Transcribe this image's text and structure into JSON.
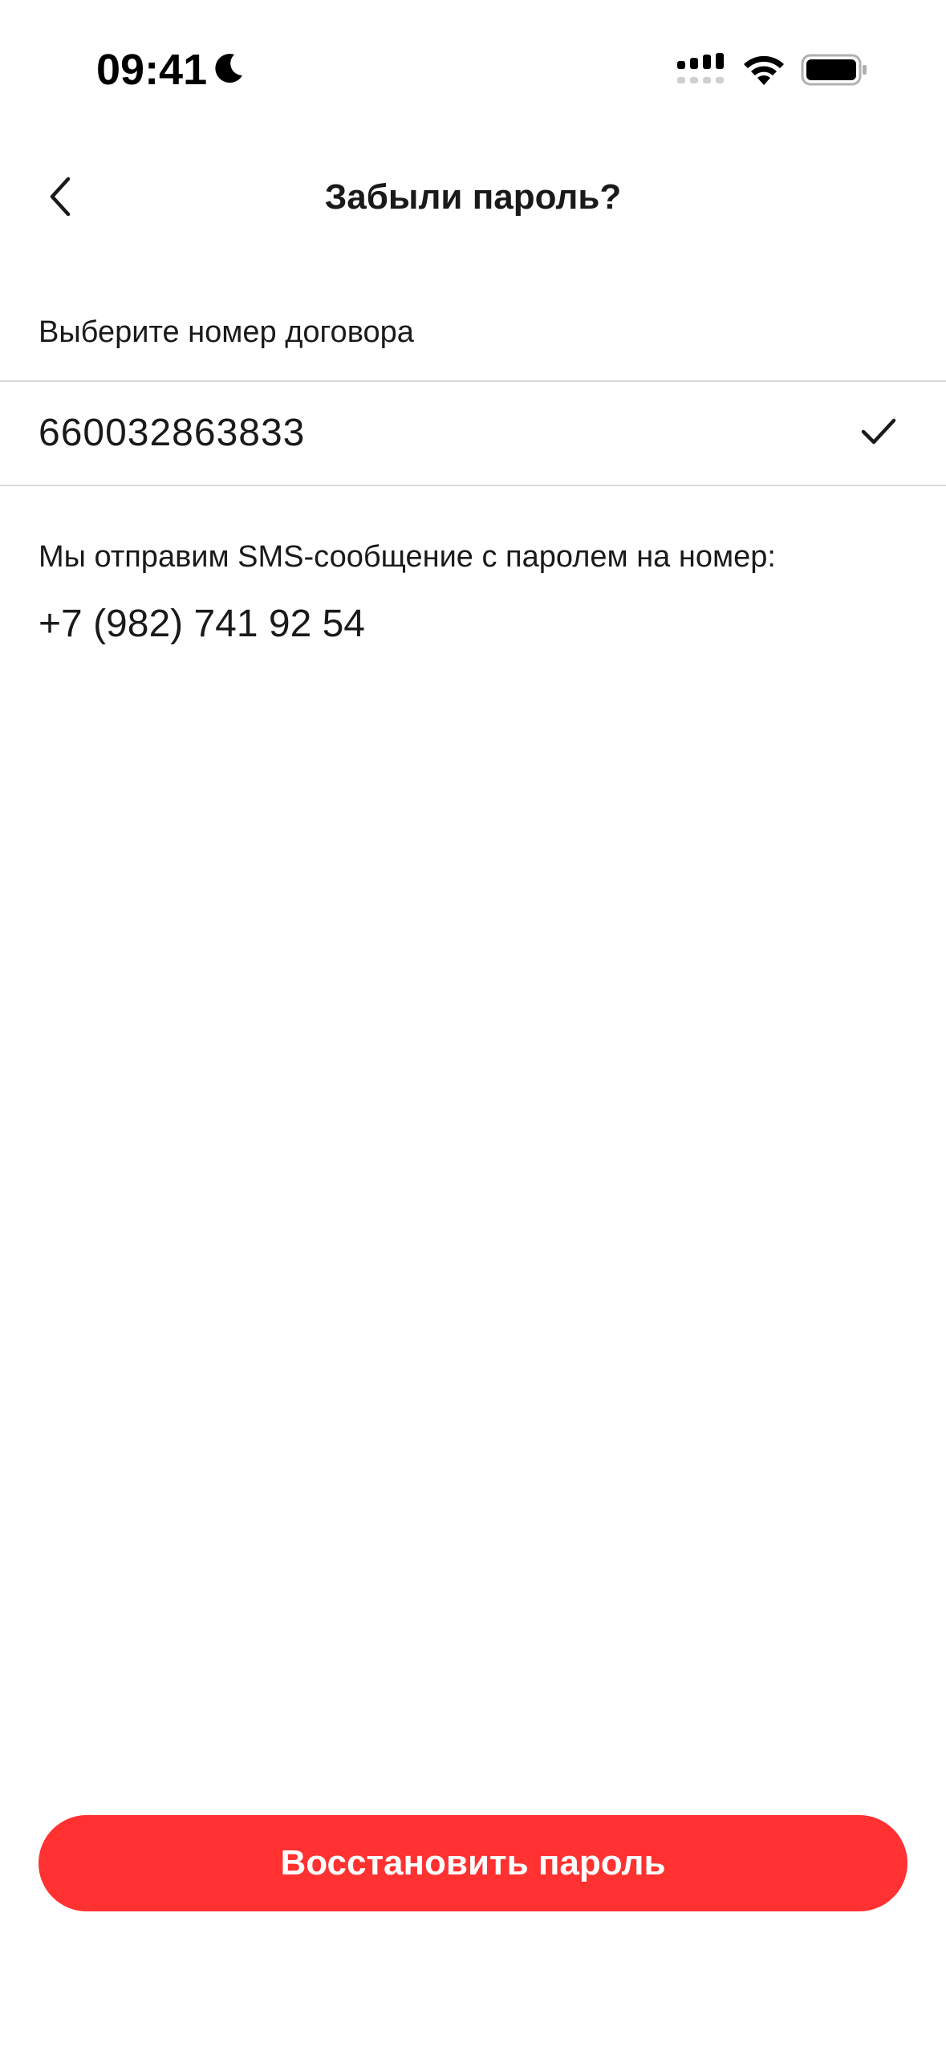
{
  "status_bar": {
    "time": "09:41"
  },
  "header": {
    "title": "Забыли пароль?"
  },
  "contract": {
    "label": "Выберите номер договора",
    "selected_number": "660032863833"
  },
  "sms": {
    "info_text": "Мы отправим SMS-сообщение с паролем на номер:",
    "phone_number": "+7 (982) 741 92 54"
  },
  "actions": {
    "restore_label": "Восстановить пароль"
  },
  "colors": {
    "accent": "#ff3131",
    "divider": "#d9d9d9",
    "text": "#1a1a1a"
  },
  "icons": {
    "back": "chevron-left-icon",
    "selected": "checkmark-icon",
    "status": [
      "moon-icon",
      "signal-icon",
      "wifi-icon",
      "battery-icon"
    ]
  }
}
